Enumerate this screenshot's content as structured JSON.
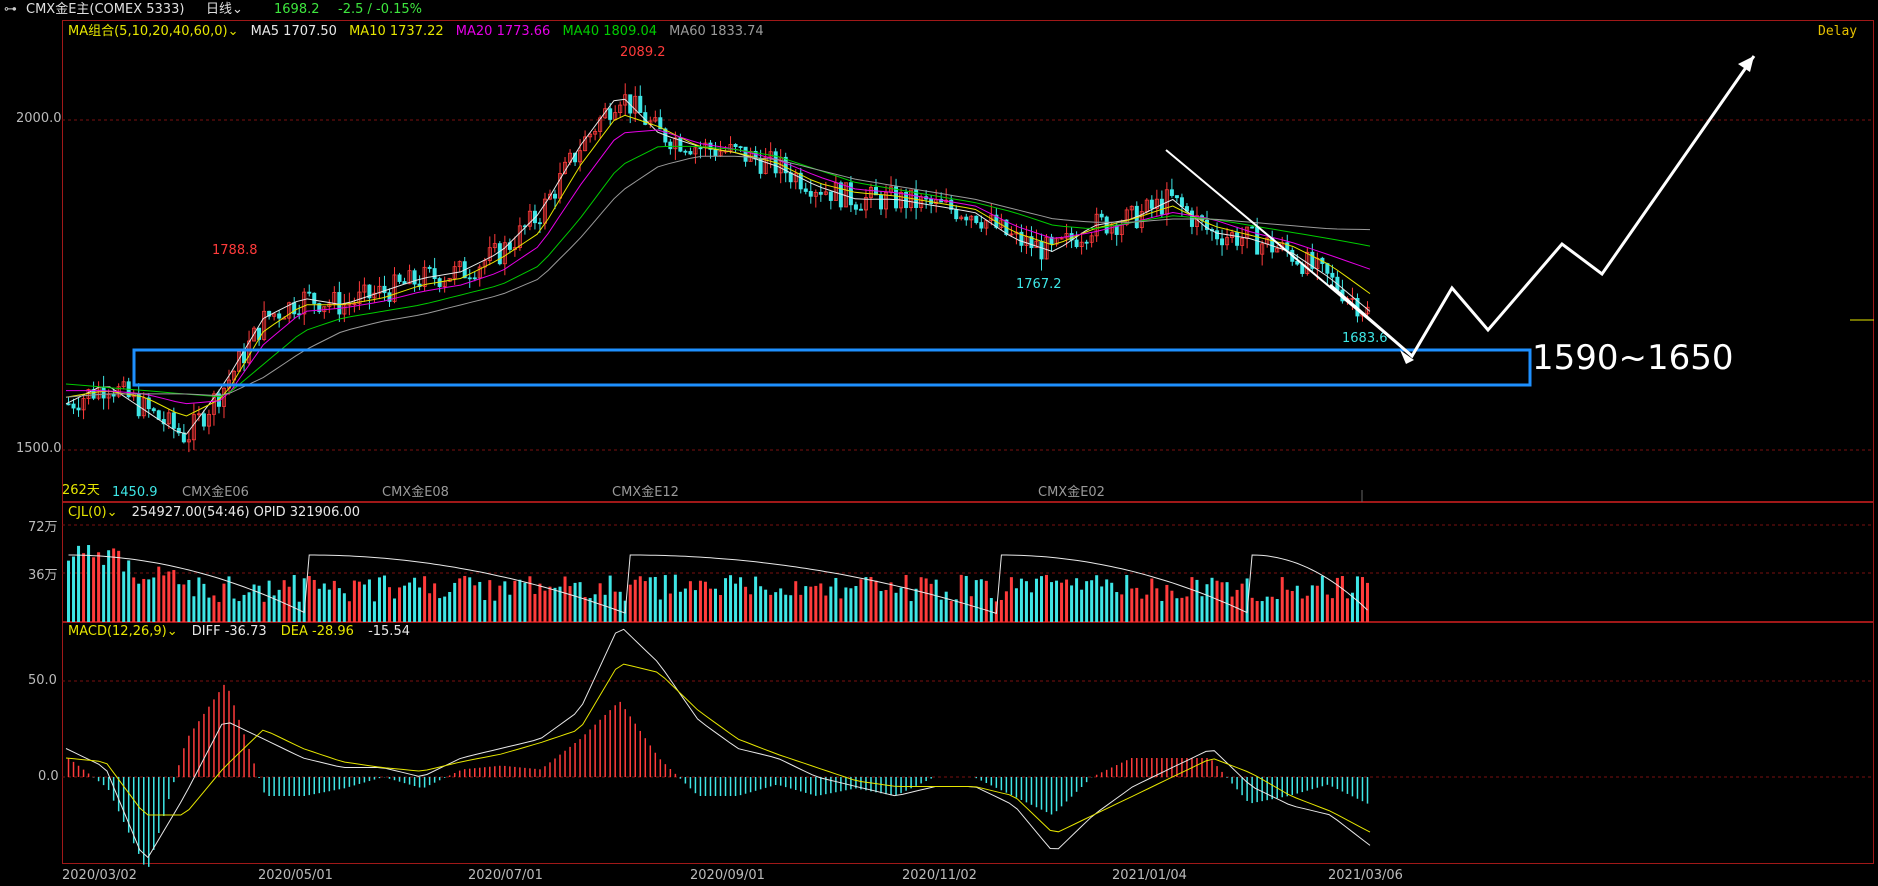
{
  "header": {
    "link_icon": "link-icon",
    "instrument": "CMX金E主(COMEX 5333)",
    "period": "日线",
    "price": "1698.2",
    "change": "-2.5 / -0.15%"
  },
  "ma_bar": {
    "title": "MA组合(5,10,20,40,60,0)",
    "ma5": "MA5 1707.50",
    "ma10": "MA10 1737.22",
    "ma20": "MA20 1773.66",
    "ma40": "MA40 1809.04",
    "ma60": "MA60 1833.74",
    "delay": "Delay"
  },
  "price_panel": {
    "y_labels": [
      "2000.0",
      "1500.0"
    ],
    "high_label": "2089.2",
    "peak1_label": "1788.8",
    "low_label": "1767.2",
    "last_label": "1683.6",
    "start_low": "1450.9",
    "days": "262天",
    "contracts": [
      "CMX金E06",
      "CMX金E08",
      "CMX金E12",
      "CMX金E02"
    ],
    "annotation": "1590~1650"
  },
  "volume_panel": {
    "title": "CJL(0)",
    "values": "254927.00(54:46)  OPID 321906.00",
    "y_labels": [
      "72万",
      "36万"
    ]
  },
  "macd_panel": {
    "title": "MACD(12,26,9)",
    "diff": "DIFF -36.73",
    "dea": "DEA -28.96",
    "macd": "-15.54",
    "y_labels": [
      "50.0",
      "0.0"
    ]
  },
  "x_axis": [
    "2020/03/02",
    "2020/05/01",
    "2020/07/01",
    "2020/09/01",
    "2020/11/02",
    "2021/01/04",
    "2021/03/06"
  ],
  "colors": {
    "up": "#ff3b3b",
    "down": "#3ee6e6",
    "ma5": "#e8e8e8",
    "ma10": "#e6e600",
    "ma20": "#e600e6",
    "ma40": "#00cc00",
    "ma60": "#9a9a9a",
    "box": "#1e90ff"
  },
  "chart_data": {
    "type": "candlestick",
    "y_range": [
      1450,
      2100
    ],
    "series": [
      {
        "name": "MA5",
        "values": [
          1570,
          1600,
          1560,
          1520,
          1600,
          1700,
          1730,
          1720,
          1740,
          1760,
          1770,
          1800,
          1860,
          1960,
          2040,
          1980,
          1960,
          1950,
          1930,
          1900,
          1880,
          1880,
          1870,
          1860,
          1820,
          1800,
          1840,
          1850,
          1880,
          1830,
          1820,
          1800,
          1760,
          1710
        ]
      },
      {
        "name": "MA10",
        "values": [
          1580,
          1590,
          1580,
          1550,
          1580,
          1680,
          1720,
          1720,
          1730,
          1750,
          1760,
          1790,
          1830,
          1930,
          2010,
          1990,
          1960,
          1950,
          1935,
          1905,
          1890,
          1885,
          1875,
          1865,
          1830,
          1810,
          1835,
          1850,
          1870,
          1840,
          1825,
          1810,
          1780,
          1737
        ]
      },
      {
        "name": "MA20",
        "values": [
          1590,
          1590,
          1585,
          1570,
          1575,
          1660,
          1710,
          1715,
          1725,
          1740,
          1750,
          1770,
          1810,
          1900,
          1980,
          1985,
          1965,
          1955,
          1940,
          1915,
          1895,
          1890,
          1880,
          1870,
          1840,
          1820,
          1830,
          1845,
          1860,
          1850,
          1830,
          1815,
          1795,
          1774
        ]
      },
      {
        "name": "MA40",
        "values": [
          1600,
          1595,
          1590,
          1585,
          1580,
          1630,
          1680,
          1700,
          1710,
          1720,
          1735,
          1750,
          1780,
          1850,
          1930,
          1960,
          1960,
          1955,
          1945,
          1925,
          1905,
          1895,
          1885,
          1875,
          1860,
          1840,
          1835,
          1845,
          1855,
          1850,
          1840,
          1830,
          1820,
          1809
        ]
      },
      {
        "name": "MA60",
        "values": [
          1580,
          1585,
          1585,
          1585,
          1582,
          1610,
          1650,
          1680,
          1695,
          1705,
          1720,
          1735,
          1760,
          1820,
          1890,
          1930,
          1945,
          1945,
          1940,
          1925,
          1910,
          1900,
          1890,
          1880,
          1865,
          1850,
          1845,
          1845,
          1850,
          1850,
          1845,
          1840,
          1835,
          1834
        ]
      }
    ]
  }
}
